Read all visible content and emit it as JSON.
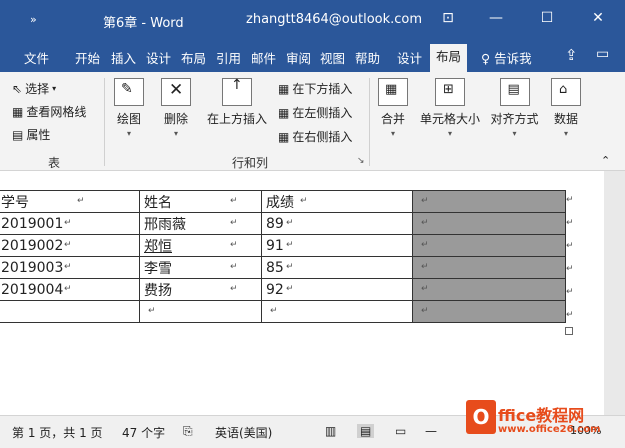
{
  "titlebar": {
    "quick_access": "»",
    "doc_title": "第6章 - Word",
    "account": "zhangtt8464@outlook.com",
    "buttons": {
      "restore": "⊡",
      "minimize": "—",
      "maximize": "☐",
      "close": "✕"
    }
  },
  "tabs": [
    "文件",
    "开始",
    "插入",
    "设计",
    "布局",
    "引用",
    "邮件",
    "审阅",
    "视图",
    "帮助",
    "设计",
    "布局"
  ],
  "tell_me": "告诉我",
  "ribbon": {
    "select": "选择",
    "view_gridlines": "查看网格线",
    "properties": "属性",
    "group_table": "表",
    "draw": "绘图",
    "delete": "删除",
    "insert_above": "在上方插入",
    "insert_below": "在下方插入",
    "insert_left": "在左侧插入",
    "insert_right": "在右侧插入",
    "group_rows_cols": "行和列",
    "merge": "合并",
    "cell_size": "单元格大小",
    "alignment": "对齐方式",
    "data": "数据"
  },
  "table": {
    "rows": [
      [
        "学号",
        "姓名",
        "成绩",
        ""
      ],
      [
        "2019001",
        "邢雨薇",
        "89",
        ""
      ],
      [
        "2019002",
        "郑恒",
        "91",
        ""
      ],
      [
        "2019003",
        "李雪",
        "85",
        ""
      ],
      [
        "2019004",
        "费扬",
        "92",
        ""
      ],
      [
        "",
        "",
        "",
        ""
      ]
    ],
    "mark": "↵"
  },
  "status": {
    "page": "第 1 页，共 1 页",
    "words": "47 个字",
    "lang": "英语(美国)",
    "zoom": "100%"
  },
  "watermark": {
    "brand": "ffice教程网",
    "url": "www.office26.com"
  },
  "colors": {
    "title_bg": "#2b579a",
    "ribbon_bg": "#f3f3f3",
    "selected_cell": "#9a9a9a",
    "logo": "#e74c1c"
  }
}
